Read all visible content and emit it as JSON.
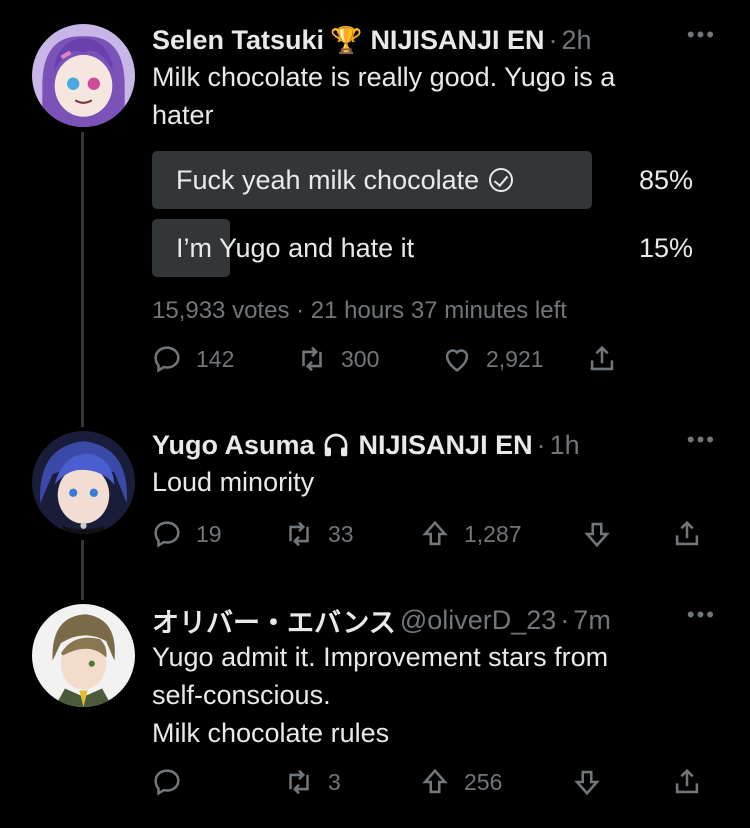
{
  "tweets": [
    {
      "name": "Selen Tatsuki",
      "name_icon": "trophy-icon",
      "affiliation": "NIJISANJI EN",
      "time": "2h",
      "text": "Milk chocolate is really good. Yugo is a\nhater",
      "poll": {
        "options": [
          {
            "label": "Fuck yeah milk chocolate",
            "percent": "85%",
            "value": 85,
            "selected": true
          },
          {
            "label": "I’m Yugo and hate it",
            "percent": "15%",
            "value": 15,
            "selected": false
          }
        ],
        "meta": "15,933 votes · 21 hours 37 minutes left"
      },
      "actions": {
        "replies": "142",
        "retweets": "300",
        "likes": "2,921"
      }
    },
    {
      "name": "Yugo Asuma",
      "name_icon": "headphones-icon",
      "affiliation": "NIJISANJI EN",
      "time": "1h",
      "text": "Loud minority",
      "actions": {
        "replies": "19",
        "retweets": "33",
        "upvotes": "1,287"
      }
    },
    {
      "name": "オリバー・エバンス",
      "handle": "@oliverD_23",
      "time": "7m",
      "text": "Yugo admit it. Improvement stars from\nself-conscious.\nMilk chocolate rules",
      "actions": {
        "replies": "",
        "retweets": "3",
        "upvotes": "256"
      }
    }
  ],
  "colors": {
    "background": "#000000",
    "text": "#e7e9ea",
    "muted": "#71767b",
    "poll_bar": "#333639"
  }
}
